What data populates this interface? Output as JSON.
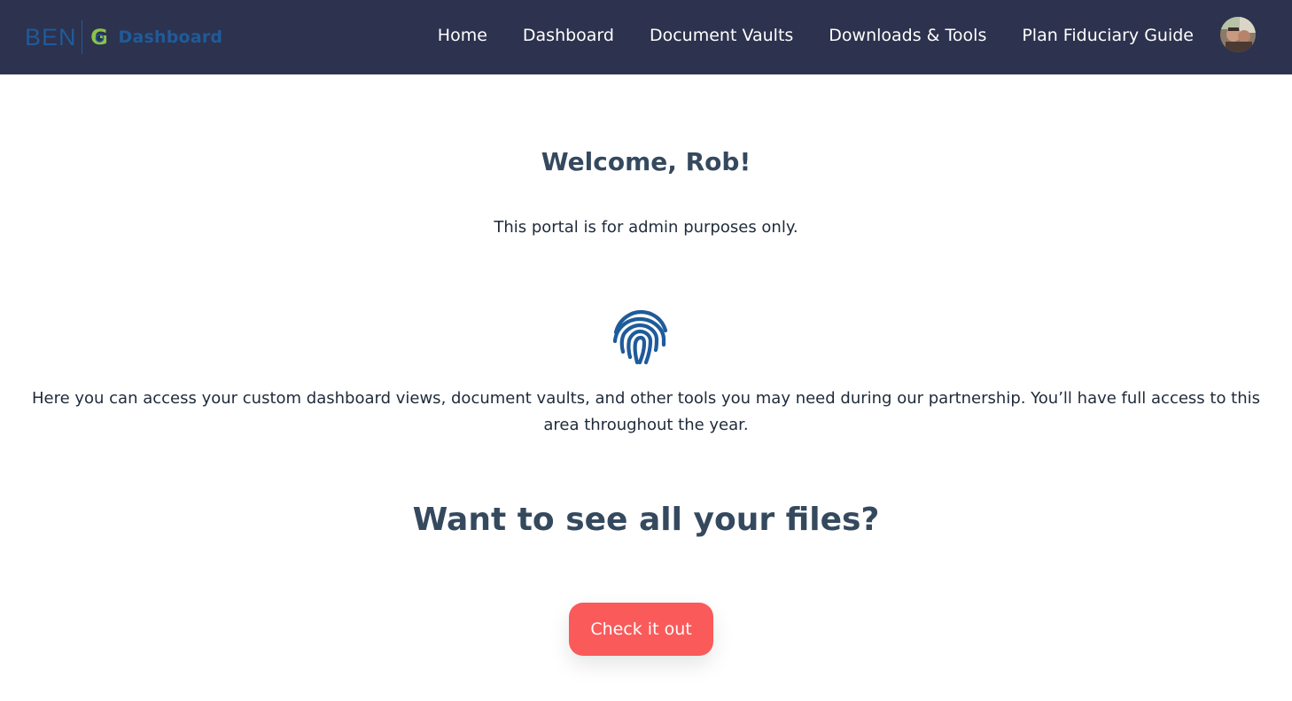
{
  "header": {
    "logo": {
      "ben_text": "BEN",
      "g_text": "G",
      "dashboard_text": "Dashboard"
    },
    "nav": [
      {
        "label": "Home"
      },
      {
        "label": "Dashboard"
      },
      {
        "label": "Document Vaults"
      },
      {
        "label": "Downloads & Tools"
      },
      {
        "label": "Plan Fiduciary Guide"
      }
    ],
    "avatar_icon": "user-avatar-photo"
  },
  "main": {
    "welcome": "Welcome, Rob!",
    "subtitle": "This portal is for admin purposes only.",
    "icon": "fingerprint-icon",
    "description": "Here you can access your custom dashboard views, document vaults, and other tools you may need during our partnership. You’ll have full access to this area throughout the year.",
    "cta_heading": "Want to see all your files?",
    "cta_button": "Check it out"
  },
  "colors": {
    "header_bg": "#2d324e",
    "brand_blue": "#1f5b9a",
    "brand_green": "#8bc34a",
    "heading": "#35495e",
    "accent": "#fa5a5a",
    "fingerprint": "#1f5b9a"
  }
}
